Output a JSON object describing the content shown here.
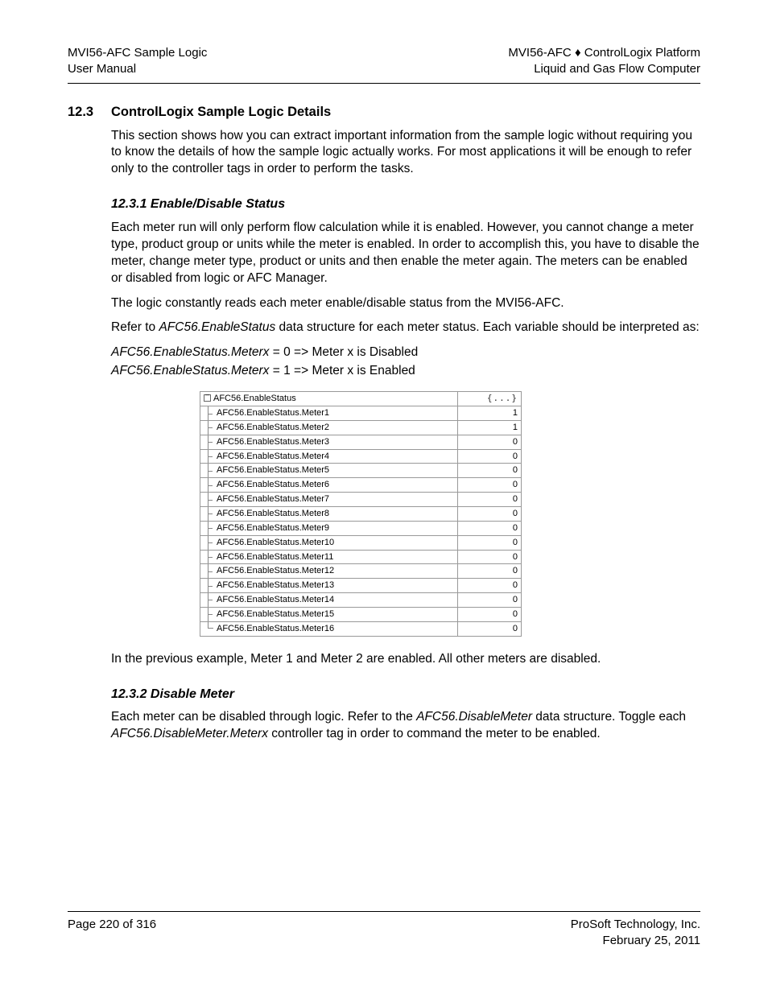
{
  "header": {
    "left_line1": "MVI56-AFC Sample Logic",
    "left_line2": "User Manual",
    "right_line1_a": "MVI56-AFC ",
    "right_line1_sep": "♦",
    "right_line1_b": " ControlLogix Platform",
    "right_line2": "Liquid and Gas Flow Computer"
  },
  "section": {
    "num": "12.3",
    "title": "ControlLogix Sample Logic Details",
    "intro": "This section shows how you can extract important information from the sample logic without requiring you to know the details of how the sample logic actually works. For most applications it will be enough to refer only to the controller tags in order to perform the tasks."
  },
  "sub1": {
    "heading": "12.3.1 Enable/Disable Status",
    "p1": "Each meter run will only perform flow calculation while it is enabled. However, you cannot change a meter type, product group or units while the meter is enabled. In order to accomplish this, you have to disable the meter, change meter type, product or units and then enable the meter again. The meters can be enabled or disabled from logic or AFC Manager.",
    "p2": "The logic constantly reads each meter enable/disable status from the MVI56-AFC.",
    "p3_a": "Refer to ",
    "p3_i": "AFC56.EnableStatus",
    "p3_b": " data structure for each meter status. Each variable should be interpreted as:",
    "line1_i": "AFC56.EnableStatus.Meterx",
    "line1_b": " = 0 => Meter x is Disabled",
    "line2_i": "AFC56.EnableStatus.Meterx",
    "line2_b": " = 1 => Meter x is Enabled",
    "after": "In the previous example, Meter 1 and Meter 2 are enabled. All other meters are disabled."
  },
  "tag_table": {
    "root_name": "AFC56.EnableStatus",
    "root_val": "{...}",
    "rows": [
      {
        "name": "AFC56.EnableStatus.Meter1",
        "val": "1"
      },
      {
        "name": "AFC56.EnableStatus.Meter2",
        "val": "1"
      },
      {
        "name": "AFC56.EnableStatus.Meter3",
        "val": "0"
      },
      {
        "name": "AFC56.EnableStatus.Meter4",
        "val": "0"
      },
      {
        "name": "AFC56.EnableStatus.Meter5",
        "val": "0"
      },
      {
        "name": "AFC56.EnableStatus.Meter6",
        "val": "0"
      },
      {
        "name": "AFC56.EnableStatus.Meter7",
        "val": "0"
      },
      {
        "name": "AFC56.EnableStatus.Meter8",
        "val": "0"
      },
      {
        "name": "AFC56.EnableStatus.Meter9",
        "val": "0"
      },
      {
        "name": "AFC56.EnableStatus.Meter10",
        "val": "0"
      },
      {
        "name": "AFC56.EnableStatus.Meter11",
        "val": "0"
      },
      {
        "name": "AFC56.EnableStatus.Meter12",
        "val": "0"
      },
      {
        "name": "AFC56.EnableStatus.Meter13",
        "val": "0"
      },
      {
        "name": "AFC56.EnableStatus.Meter14",
        "val": "0"
      },
      {
        "name": "AFC56.EnableStatus.Meter15",
        "val": "0"
      },
      {
        "name": "AFC56.EnableStatus.Meter16",
        "val": "0"
      }
    ]
  },
  "sub2": {
    "heading": "12.3.2 Disable Meter",
    "p_a": "Each meter can be disabled through logic. Refer to the ",
    "p_i1": "AFC56.DisableMeter",
    "p_b": " data structure. Toggle each ",
    "p_i2": "AFC56.DisableMeter.Meterx",
    "p_c": " controller tag in order to command the meter to be enabled."
  },
  "footer": {
    "left": "Page 220 of 316",
    "right1": "ProSoft Technology, Inc.",
    "right2": "February 25, 2011"
  }
}
